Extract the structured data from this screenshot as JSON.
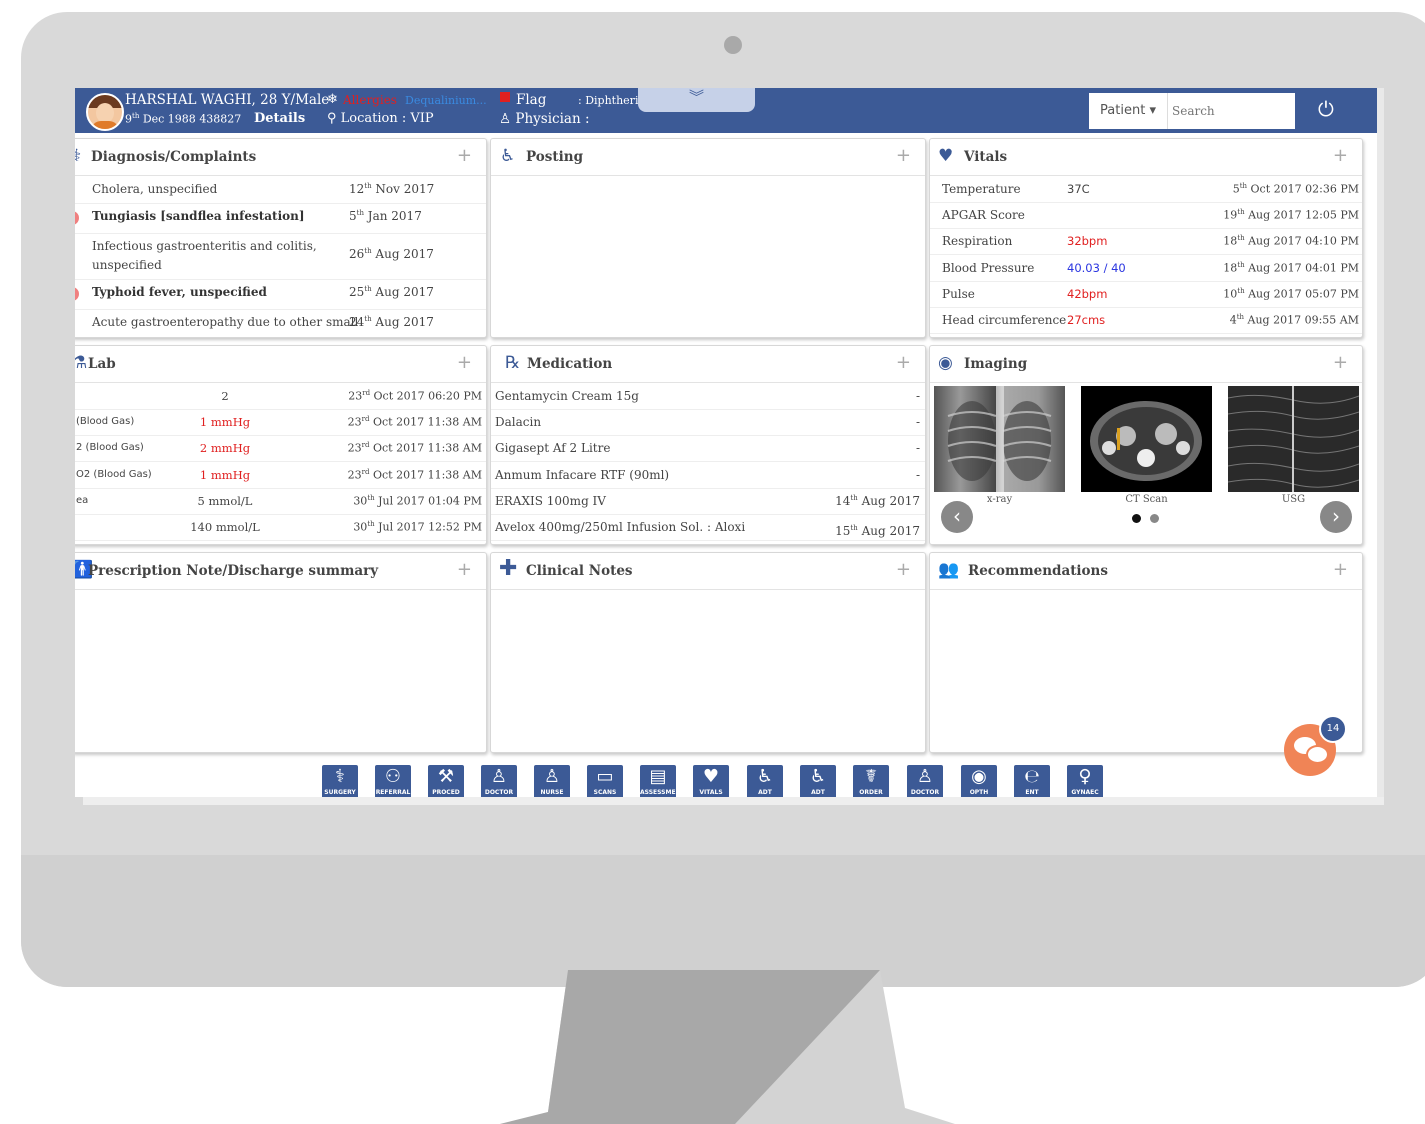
{
  "patient": {
    "name": "HARSHAL WAGHI, 28 Y/Male",
    "dob": "9th Dec 1988",
    "dob_day": "9",
    "dob_sup": "th",
    "dob_rest": " Dec 1988",
    "id": "438827",
    "details_label": "Details",
    "allergies_label": "Allergies",
    "allergies_value": "Dequalinium...",
    "location": "Location : VIP",
    "flag_label": "Flag",
    "flag_value": ": Diphtheria...",
    "physician": "Physician :"
  },
  "header": {
    "patient_select": "Patient",
    "search_placeholder": "Search"
  },
  "diagnosis": {
    "title": "Diagnosis/Complaints",
    "rows": [
      {
        "name": "Cholera, unspecified",
        "day": "12",
        "sup": "th",
        "rest": " Nov 2017",
        "bold": false
      },
      {
        "name": "Tungiasis [sandflea infestation]",
        "day": "5",
        "sup": "th",
        "rest": " Jan 2017",
        "bold": true
      },
      {
        "name": "Infectious gastroenteritis and colitis, unspecified",
        "day": "26",
        "sup": "th",
        "rest": " Aug 2017",
        "bold": false
      },
      {
        "name": "Typhoid fever, unspecified",
        "day": "25",
        "sup": "th",
        "rest": " Aug 2017",
        "bold": true
      },
      {
        "name": "Acute gastroenteropathy due to other small",
        "day": "24",
        "sup": "th",
        "rest": " Aug 2017",
        "bold": false
      }
    ]
  },
  "posting": {
    "title": "Posting"
  },
  "vitals": {
    "title": "Vitals",
    "rows": [
      {
        "name": "Temperature",
        "value": "37C",
        "day": "5",
        "sup": "th",
        "rest": " Oct 2017 02:36 PM",
        "color": "plain"
      },
      {
        "name": "APGAR Score",
        "value": "",
        "day": "19",
        "sup": "th",
        "rest": " Aug 2017 12:05 PM",
        "color": "plain"
      },
      {
        "name": "Respiration",
        "value": "32bpm",
        "day": "18",
        "sup": "th",
        "rest": " Aug 2017 04:10 PM",
        "color": "red"
      },
      {
        "name": "Blood Pressure",
        "value": "40.03 / 40",
        "day": "18",
        "sup": "th",
        "rest": " Aug 2017 04:01 PM",
        "color": "blue"
      },
      {
        "name": "Pulse",
        "value": "42bpm",
        "day": "10",
        "sup": "th",
        "rest": " Aug 2017 05:07 PM",
        "color": "red"
      },
      {
        "name": "Head circumference",
        "value": "27cms",
        "day": "4",
        "sup": "th",
        "rest": " Aug 2017 09:55 AM",
        "color": "red"
      }
    ]
  },
  "lab": {
    "title": "Lab",
    "rows": [
      {
        "name": "",
        "value": "2",
        "day": "23",
        "sup": "rd",
        "rest": " Oct 2017 06:20 PM",
        "color": "plain"
      },
      {
        "name": "(Blood Gas)",
        "value": "1 mmHg",
        "day": "23",
        "sup": "rd",
        "rest": " Oct 2017 11:38 AM",
        "color": "red"
      },
      {
        "name": "2 (Blood Gas)",
        "value": "2 mmHg",
        "day": "23",
        "sup": "rd",
        "rest": " Oct 2017 11:38 AM",
        "color": "red"
      },
      {
        "name": "O2 (Blood Gas)",
        "value": "1 mmHg",
        "day": "23",
        "sup": "rd",
        "rest": " Oct 2017 11:38 AM",
        "color": "red"
      },
      {
        "name": "ea",
        "value": "5 mmol/L",
        "day": "30",
        "sup": "th",
        "rest": " Jul 2017 01:04 PM",
        "color": "plain"
      },
      {
        "name": "",
        "value": "140 mmol/L",
        "day": "30",
        "sup": "th",
        "rest": " Jul 2017 12:52 PM",
        "color": "plain"
      }
    ]
  },
  "medication": {
    "title": "Medication",
    "rows": [
      {
        "name": "Gentamycin Cream 15g",
        "date": "-"
      },
      {
        "name": "Dalacin",
        "date": "-"
      },
      {
        "name": "Gigasept Af 2 Litre",
        "date": "-"
      },
      {
        "name": "Anmum Infacare RTF (90ml)",
        "date": "-"
      },
      {
        "name": "ERAXIS 100mg IV",
        "date": "14th Aug 2017",
        "day": "14",
        "sup": "th",
        "rest": " Aug 2017"
      },
      {
        "name": "Avelox 400mg/250ml Infusion Sol. : Aloxi",
        "date": "15th Aug 2017",
        "day": "15",
        "sup": "th",
        "rest": " Aug 2017"
      }
    ]
  },
  "imaging": {
    "title": "Imaging",
    "items": [
      {
        "caption": "x-ray"
      },
      {
        "caption": "CT Scan"
      },
      {
        "caption": "USG"
      }
    ]
  },
  "prescription": {
    "title": "Prescription Note/Discharge summary"
  },
  "clinical_notes": {
    "title": "Clinical Notes"
  },
  "recommendations": {
    "title": "Recommendations"
  },
  "toolbar": [
    {
      "icon": "surgery-icon",
      "label": "SURGERY"
    },
    {
      "icon": "referral-icon",
      "label": "REFERRAL"
    },
    {
      "icon": "procedure-icon",
      "label": "PROCED"
    },
    {
      "icon": "doctor-icon",
      "label": "DOCTOR"
    },
    {
      "icon": "nurse-icon",
      "label": "NURSE"
    },
    {
      "icon": "scans-icon",
      "label": "SCANS"
    },
    {
      "icon": "document-icon",
      "label": "ASSESSMENT"
    },
    {
      "icon": "vitals-heart-icon",
      "label": "VITALS"
    },
    {
      "icon": "wheelchair-icon",
      "label": "ADT"
    },
    {
      "icon": "wheelchair-icon",
      "label": "ADT"
    },
    {
      "icon": "order-icon",
      "label": "ORDER"
    },
    {
      "icon": "doctor-icon",
      "label": "DOCTOR"
    },
    {
      "icon": "eye-icon",
      "label": "OPTH"
    },
    {
      "icon": "ear-icon",
      "label": "ENT"
    },
    {
      "icon": "gynaec-icon",
      "label": "GYNAEC"
    }
  ],
  "chat": {
    "count": "14"
  },
  "colors": {
    "header_blue": "#3c5a96",
    "alert_red": "#e02020",
    "value_blue": "#2a35e0",
    "chat_orange": "#f08456"
  }
}
